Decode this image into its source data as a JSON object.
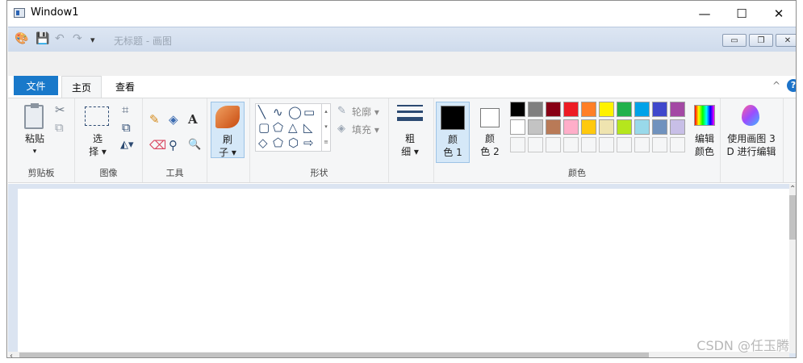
{
  "window": {
    "title": "Window1",
    "minimize": "—",
    "maximize": "☐",
    "close": "✕"
  },
  "qat": {
    "doc_title": "无标题 - 画图",
    "paint_icon": "palette-icon",
    "save_icon": "save-icon",
    "undo_icon": "undo-icon",
    "redo_icon": "redo-icon",
    "customize_icon": "dropdown-icon"
  },
  "mdi": {
    "minimize": "▭",
    "restore": "❐",
    "close": "✕"
  },
  "tabs": {
    "file": "文件",
    "home": "主页",
    "view": "查看",
    "collapse": "^",
    "help": "?"
  },
  "groups": {
    "clipboard": {
      "label": "剪贴板",
      "paste": "粘贴",
      "paste_arrow": "▾",
      "cut": "✂",
      "copy": "⧉"
    },
    "image": {
      "label": "图像",
      "select_1": "选",
      "select_2": "择 ▾",
      "crop": "⌗",
      "resize": "⧉",
      "rotate": "◭▾"
    },
    "tools": {
      "label": "工具",
      "pencil": "✎",
      "fill": "◈",
      "text": "A",
      "eraser": "⌫",
      "picker": "⚲",
      "magnifier": "🔍"
    },
    "brushes": {
      "label_1": "刷",
      "label_2": "子 ▾"
    },
    "shapes": {
      "label": "形状",
      "outline": "轮廓 ▾",
      "fill": "填充 ▾",
      "items": [
        "╲",
        "∿",
        "◯",
        "▭",
        "▢",
        "⬠",
        "△",
        "◺",
        "◇",
        "⬠",
        "⬡",
        "⇨"
      ]
    },
    "size": {
      "label_1": "粗",
      "label_2": "细 ▾"
    },
    "colors": {
      "label": "颜色",
      "color1_1": "颜",
      "color1_2": "色 1",
      "color2_1": "颜",
      "color2_2": "色 2",
      "edit_1": "编辑",
      "edit_2": "颜色",
      "color1_value": "#000000",
      "color2_value": "#ffffff",
      "row1": [
        "#000000",
        "#7f7f7f",
        "#880015",
        "#ed1c24",
        "#ff7f27",
        "#fff200",
        "#22b14c",
        "#00a2e8",
        "#3f48cc",
        "#a349a4"
      ],
      "row2": [
        "#ffffff",
        "#c3c3c3",
        "#b97a57",
        "#ffaec9",
        "#ffc90e",
        "#efe4b0",
        "#b5e61d",
        "#99d9ea",
        "#7092be",
        "#c8bfe7"
      ],
      "row3": [
        "#f5f6f7",
        "#f5f6f7",
        "#f5f6f7",
        "#f5f6f7",
        "#f5f6f7",
        "#f5f6f7",
        "#f5f6f7",
        "#f5f6f7",
        "#f5f6f7",
        "#f5f6f7"
      ]
    },
    "paint3d": {
      "label_1": "使用画图 3",
      "label_2": "D 进行编辑"
    }
  },
  "watermark": "CSDN @任玉腾"
}
